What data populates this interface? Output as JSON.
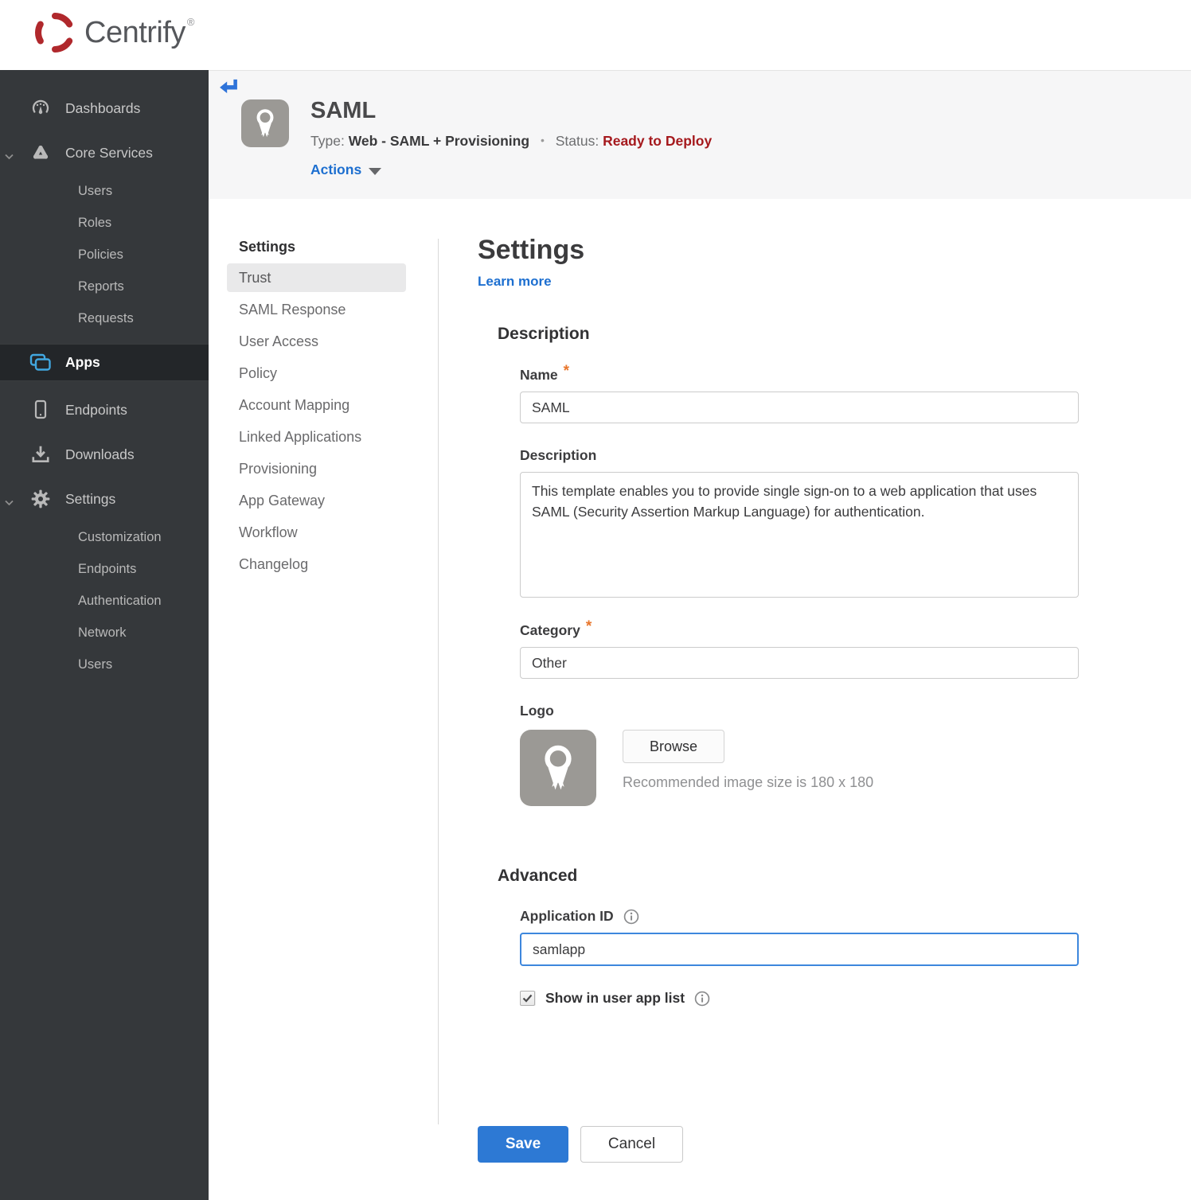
{
  "brand": {
    "name": "Centrify",
    "registered": "®"
  },
  "colors": {
    "brand_red": "#b0282c",
    "sidebar_bg": "#35383b",
    "apps_icon_blue": "#41a7e0",
    "link_blue": "#1d6fd0",
    "accent_blue": "#2d79d4",
    "focused_input_blue": "#3d87dd",
    "status_red": "#a5191d",
    "required_orange": "#e8762c",
    "band_gray": "#f6f6f7"
  },
  "sidebar": {
    "dashboards": "Dashboards",
    "core_services": "Core Services",
    "core_children": [
      "Users",
      "Roles",
      "Policies",
      "Reports",
      "Requests"
    ],
    "apps": "Apps",
    "endpoints": "Endpoints",
    "downloads": "Downloads",
    "settings": "Settings",
    "settings_children": [
      "Customization",
      "Endpoints",
      "Authentication",
      "Network",
      "Users"
    ]
  },
  "app_header": {
    "title": "SAML",
    "type_label": "Type:",
    "type_value": "Web - SAML + Provisioning",
    "separator": "•",
    "status_label": "Status:",
    "status_value": "Ready to Deploy",
    "actions_label": "Actions"
  },
  "subnav": {
    "header": "Settings",
    "active_item": "Trust",
    "items": [
      "Trust",
      "SAML Response",
      "User Access",
      "Policy",
      "Account Mapping",
      "Linked Applications",
      "Provisioning",
      "App Gateway",
      "Workflow",
      "Changelog"
    ]
  },
  "form": {
    "title": "Settings",
    "learn_more": "Learn more",
    "description_section": "Description",
    "name_label": "Name",
    "required_marker": "*",
    "name_value": "SAML",
    "description_label": "Description",
    "description_value": "This template enables you to provide single sign-on to a web application that uses SAML (Security Assertion Markup Language) for authentication.",
    "category_label": "Category",
    "category_value": "Other",
    "logo_label": "Logo",
    "browse_button": "Browse",
    "logo_hint": "Recommended image size is 180 x 180",
    "advanced_section": "Advanced",
    "application_id_label": "Application ID",
    "application_id_value": "samlapp",
    "show_in_app_list_label": "Show in user app list",
    "show_in_app_list_checked": true,
    "save_button": "Save",
    "cancel_button": "Cancel"
  }
}
